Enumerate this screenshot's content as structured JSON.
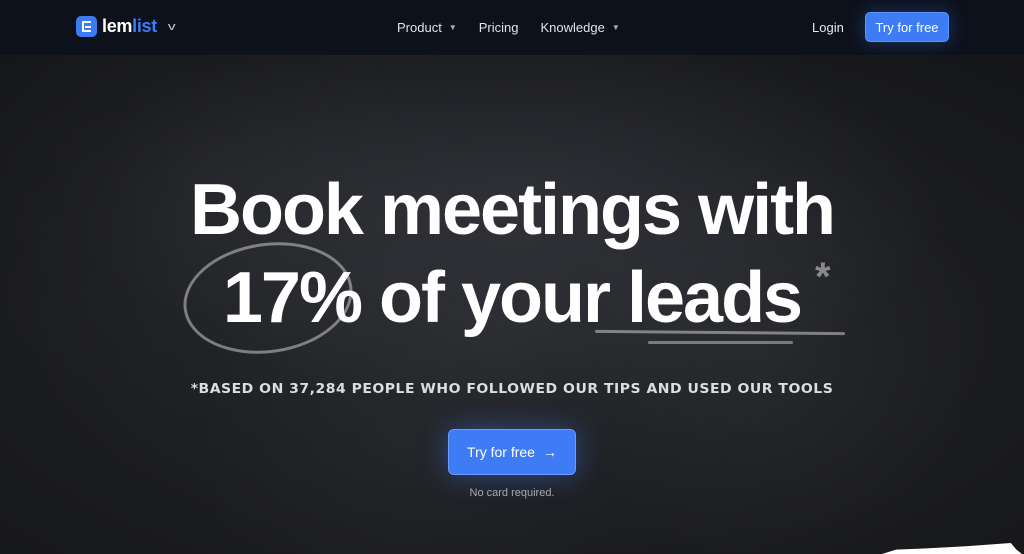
{
  "nav": {
    "logo": {
      "part1": "lem",
      "part2": "list",
      "icon": "lemlist-logo-icon",
      "chevron": "⌄"
    },
    "menu": [
      {
        "label": "Product",
        "has_dropdown": true
      },
      {
        "label": "Pricing",
        "has_dropdown": false
      },
      {
        "label": "Knowledge",
        "has_dropdown": true
      }
    ],
    "login_label": "Login",
    "cta_label": "Try for free"
  },
  "hero": {
    "line1": "Book meetings with",
    "line2_highlight": "17%",
    "line2_middle": " of your ",
    "line2_underlined": "leads",
    "asterisk": "*",
    "footnote": "*BASED ON 37,284 PEOPLE WHO FOLLOWED OUR TIPS AND USED OUR TOOLS",
    "cta_label": "Try for free",
    "cta_arrow": "→",
    "subtext": "No card required."
  },
  "colors": {
    "accent": "#3d7cf5",
    "nav_bg": "#0d111b",
    "hero_bg": "#1c1e22"
  }
}
